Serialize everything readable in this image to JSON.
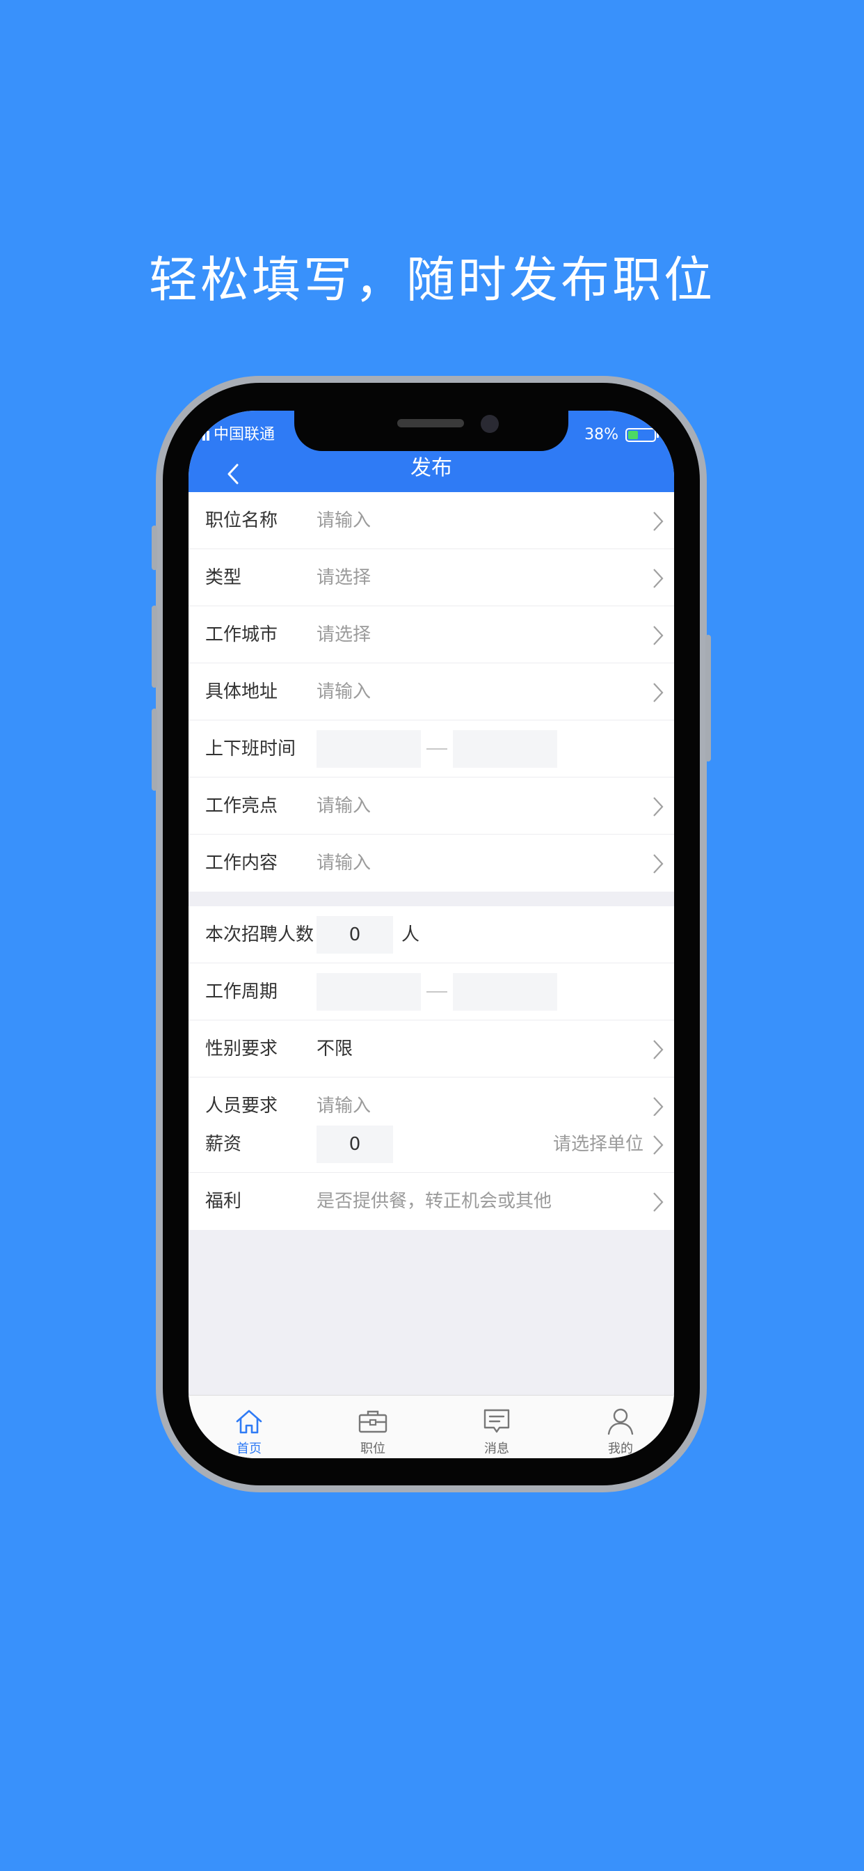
{
  "headline": "轻松填写，随时发布职位",
  "status_bar": {
    "carrier": "中国联通",
    "battery": "38%"
  },
  "nav": {
    "title": "发布"
  },
  "group1": [
    {
      "label": "职位名称",
      "value": "请输入"
    },
    {
      "label": "类型",
      "value": "请选择"
    },
    {
      "label": "工作城市",
      "value": "请选择"
    },
    {
      "label": "具体地址",
      "value": "请输入"
    },
    {
      "label": "上下班时间",
      "start": "",
      "end": ""
    },
    {
      "label": "工作亮点",
      "value": "请输入"
    },
    {
      "label": "工作内容",
      "value": "请输入"
    }
  ],
  "group2": [
    {
      "label": "本次招聘人数",
      "value": "0",
      "unit": "人"
    },
    {
      "label": "工作周期",
      "start": "",
      "end": ""
    },
    {
      "label": "性别要求",
      "value": "不限"
    },
    {
      "label": "人员要求",
      "value": "请输入"
    }
  ],
  "group3": [
    {
      "label": "薪资",
      "value": "0",
      "unit_hint": "请选择单位"
    },
    {
      "label": "福利",
      "value": "是否提供餐，转正机会或其他"
    }
  ],
  "tabbar": [
    {
      "label": "首页",
      "icon": "home-icon",
      "active": true
    },
    {
      "label": "职位",
      "icon": "briefcase-icon",
      "active": false
    },
    {
      "label": "消息",
      "icon": "message-icon",
      "active": false
    },
    {
      "label": "我的",
      "icon": "person-icon",
      "active": false
    }
  ],
  "colors": {
    "background": "#3991fb",
    "primary": "#2f7bf5",
    "battery": "#4cd964"
  }
}
